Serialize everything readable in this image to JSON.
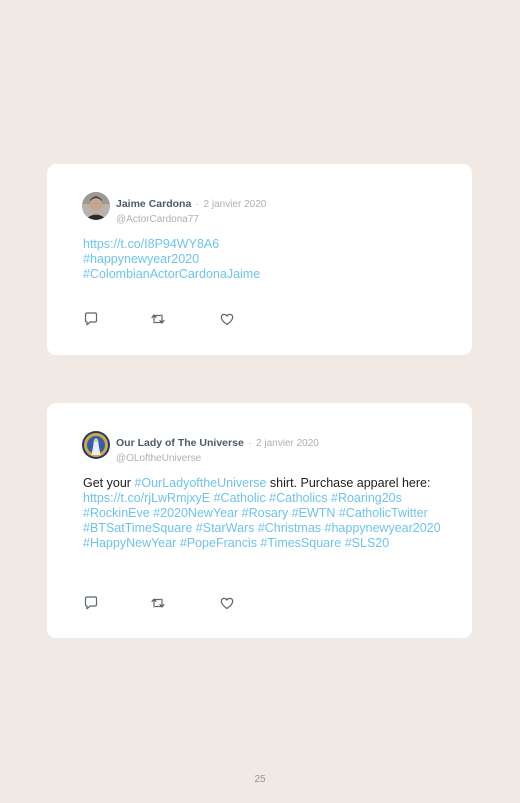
{
  "posts": [
    {
      "author": "Jaime Cardona",
      "separator": "·",
      "date": "2 janvier 2020",
      "handle": "@ActorCardona77",
      "lines": [
        "https://t.co/I8P94WY8A6",
        "#happynewyear2020",
        "#ColombianActorCardonaJaime"
      ]
    },
    {
      "author": "Our Lady of The Universe",
      "separator": "·",
      "date": "2 janvier 2020",
      "handle": "@OLoftheUniverse",
      "text_1": "Get your ",
      "link_1": "#OurLadyoftheUniverse",
      "text_2": " shirt. Purchase apparel here: ",
      "link_2": "https://t.co/rjLwRmjxyE #Catholic #Catholics #Roaring20s #RockinEve #2020NewYear #Rosary #EWTN #CatholicTwitter #BTSatTimeSquare #StarWars #Christmas #happynewyear2020 #HappyNewYear #PopeFrancis #TimesSquare #SLS20"
    }
  ],
  "icons": [
    "reply-icon",
    "retweet-icon",
    "like-icon"
  ],
  "colors": {
    "link": "#6fc3ea",
    "background": "#f1e9e4",
    "card": "#ffffff"
  },
  "page_number": "25"
}
